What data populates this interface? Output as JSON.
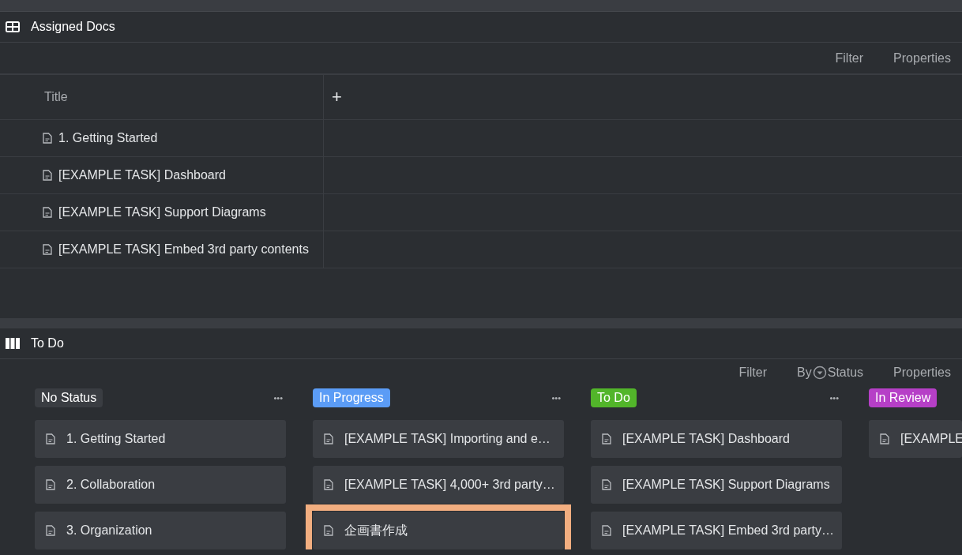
{
  "table_view": {
    "title": "Assigned Docs",
    "toolbar": [
      "Filter",
      "Properties"
    ],
    "columns": [
      "Title"
    ],
    "add_column": "+",
    "rows": [
      "1. Getting Started",
      "[EXAMPLE TASK] Dashboard",
      "[EXAMPLE TASK] Support Diagrams",
      "[EXAMPLE TASK] Embed 3rd party contents"
    ]
  },
  "board_view": {
    "title": "To Do",
    "toolbar": {
      "filter": "Filter",
      "group_prefix": "By",
      "group_field": "Status",
      "properties": "Properties"
    },
    "columns": [
      {
        "label": "No Status",
        "color": "#3a3d42",
        "more": "•••",
        "cards": [
          {
            "title": "1. Getting Started",
            "highlighted": false
          },
          {
            "title": "2. Collaboration",
            "highlighted": false
          },
          {
            "title": "3. Organization",
            "highlighted": false
          }
        ]
      },
      {
        "label": "In Progress",
        "color": "#5b9cf6",
        "more": "•••",
        "cards": [
          {
            "title": "[EXAMPLE TASK] Importing and e…",
            "highlighted": false
          },
          {
            "title": "[EXAMPLE TASK] 4,000+ 3rd party…",
            "highlighted": false
          },
          {
            "title": "企画書作成",
            "highlighted": true
          }
        ]
      },
      {
        "label": "To Do",
        "color": "#52b52a",
        "more": "•••",
        "cards": [
          {
            "title": "[EXAMPLE TASK] Dashboard",
            "highlighted": false
          },
          {
            "title": "[EXAMPLE TASK] Support Diagrams",
            "highlighted": false
          },
          {
            "title": "[EXAMPLE TASK] Embed 3rd party…",
            "highlighted": false
          }
        ]
      },
      {
        "label": "In Review",
        "color": "#b63fc7",
        "cards": [
          {
            "title": "[EXAMPLE",
            "highlighted": false
          }
        ]
      }
    ]
  }
}
